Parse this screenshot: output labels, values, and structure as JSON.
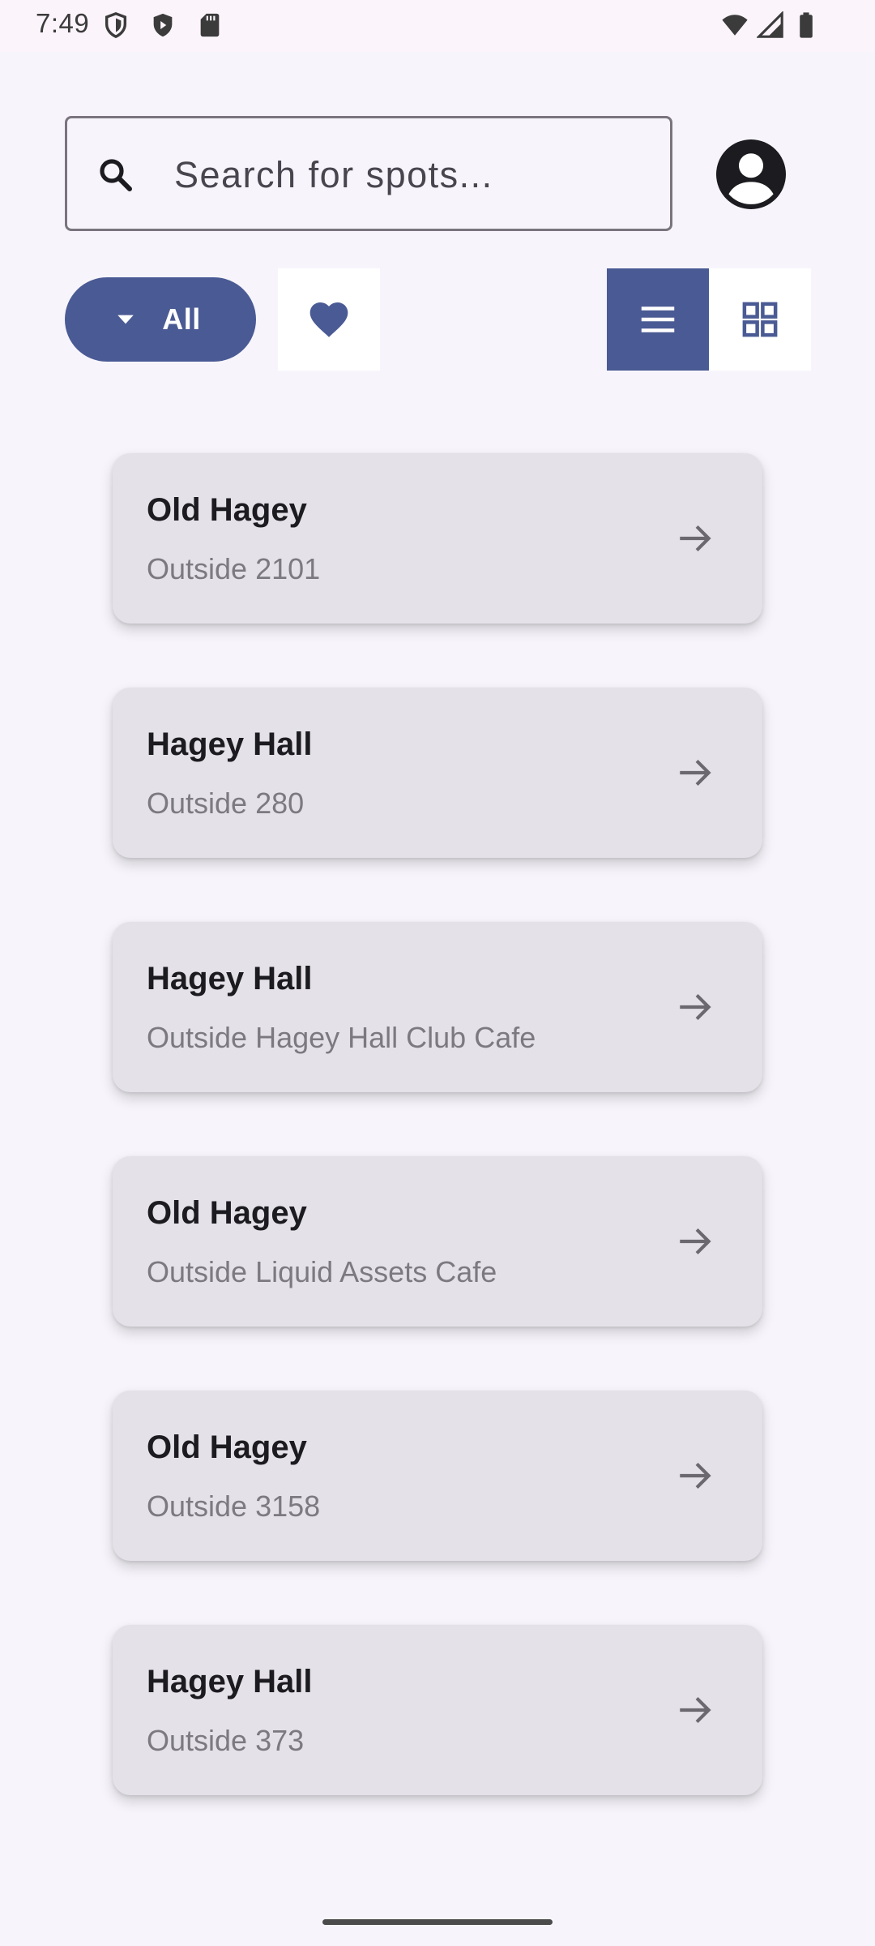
{
  "status_bar": {
    "time": "7:49",
    "left_icons": [
      "shield-icon",
      "play-protect-icon",
      "sd-card-icon"
    ],
    "right_icons": [
      "wifi-icon",
      "signal-icon",
      "battery-icon"
    ]
  },
  "search": {
    "placeholder": "Search for spots...",
    "value": "",
    "icon": "search-icon"
  },
  "profile": {
    "icon": "account-circle-icon"
  },
  "filter": {
    "selected": "All",
    "icon": "dropdown-arrow-icon"
  },
  "favorites": {
    "icon": "heart-icon"
  },
  "view_toggle": {
    "selected": "list",
    "options": [
      "list",
      "grid"
    ]
  },
  "spots": [
    {
      "name": "Old Hagey",
      "location": "Outside 2101"
    },
    {
      "name": "Hagey Hall",
      "location": "Outside 280"
    },
    {
      "name": "Hagey Hall",
      "location": "Outside Hagey Hall Club Cafe"
    },
    {
      "name": "Old Hagey",
      "location": "Outside Liquid Assets Cafe"
    },
    {
      "name": "Old Hagey",
      "location": "Outside 3158"
    },
    {
      "name": "Hagey Hall",
      "location": "Outside 373"
    }
  ],
  "colors": {
    "accent": "#4a5a94",
    "background": "#f7f5fb",
    "card": "#e4e2e8",
    "secondary_text": "#7c7a80"
  }
}
